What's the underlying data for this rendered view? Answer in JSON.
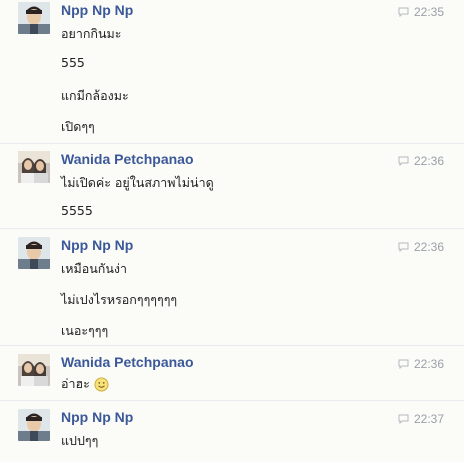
{
  "conversation": {
    "groups": [
      {
        "sender": "Npp Np Np",
        "time": "22:35",
        "avatar": "avatar-male",
        "messages": [
          "อยากกินมะ",
          "555",
          "แกมีกล้องมะ",
          "เปิดๆๆ"
        ]
      },
      {
        "sender": "Wanida Petchpanao",
        "time": "22:36",
        "avatar": "avatar-female",
        "messages": [
          "ไม่เปิดค่ะ อยู่ในสภาพไม่น่าดู",
          "5555"
        ]
      },
      {
        "sender": "Npp Np Np",
        "time": "22:36",
        "avatar": "avatar-male",
        "messages": [
          "เหมือนกันง่า",
          "ไม่เปงไรหรอกๆๆๆๆๆๆ",
          "เนอะๆๆๆ"
        ]
      },
      {
        "sender": "Wanida Petchpanao",
        "time": "22:36",
        "avatar": "avatar-female",
        "messages": [
          "อ่าฮะ"
        ],
        "emoji": "smiley-emoji"
      },
      {
        "sender": "Npp Np Np",
        "time": "22:37",
        "avatar": "avatar-male",
        "messages": [
          "แปปๆๆ"
        ]
      }
    ]
  },
  "colors": {
    "sender_name": "#3b5998",
    "timestamp": "#9aa0a8",
    "message_text": "#222222",
    "background": "#fbfbf8"
  },
  "icons": {
    "timestamp": "chat-bubble-icon",
    "emoji": "smiley-emoji"
  }
}
